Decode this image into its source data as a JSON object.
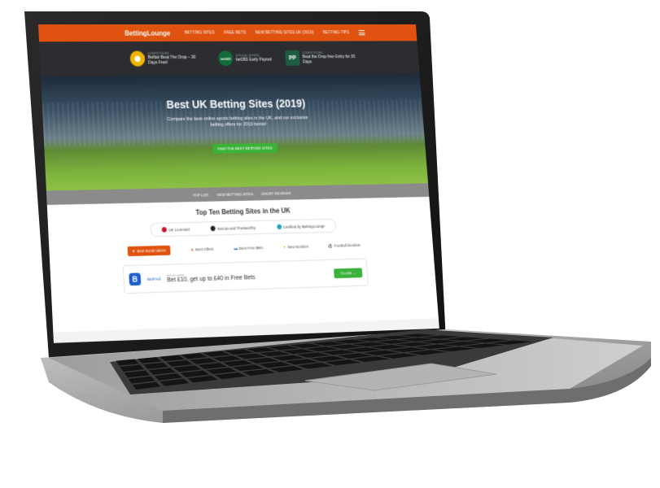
{
  "nav": {
    "brand": "BettingLounge",
    "links": [
      "BETTING SITES",
      "FREE BETS",
      "NEW BETTING SITES UK (2019)",
      "BETTING TIPS"
    ]
  },
  "promos": [
    {
      "logo_text": "",
      "logo_color": "#f0b400",
      "kicker": "COMPETITIONS",
      "title": "Betfair Beat The Drop – 30 Days Free!"
    },
    {
      "logo_text": "bet365",
      "logo_color": "#136c3b",
      "kicker": "SPECIAL OFFERS",
      "title": "bet365 Early Payout"
    },
    {
      "logo_text": "PP",
      "logo_color": "#1d5e42",
      "kicker": "COMPETITIONS",
      "title": "Beat the Drop free Entry for 30 Days"
    }
  ],
  "hero": {
    "title": "Best UK Betting Sites (2019)",
    "subtitle": "Compare the best online sports betting sites in the UK, and our exclusive betting offers for 2019 below!",
    "cta": "FIND THE BEST BETTING SITES"
  },
  "tabs": [
    "TOP LIST",
    "NEW BETTING SITES",
    "SHORT REVIEWS"
  ],
  "content": {
    "heading": "Top Ten Betting Sites in the UK",
    "badges": [
      {
        "label": "UK Licensed",
        "color": "#c8102e"
      },
      {
        "label": "Secure and Trustworthy",
        "color": "#222222"
      },
      {
        "label": "Certified by BettingLounge",
        "color": "#2aa2c7"
      }
    ],
    "filters": [
      {
        "label": "Best Bookmakers",
        "active": true
      },
      {
        "label": "Best Offers",
        "active": false
      },
      {
        "label": "Best Free Bets",
        "active": false
      },
      {
        "label": "New Bookies",
        "active": false
      },
      {
        "label": "Football Bookies",
        "active": false
      }
    ],
    "card": {
      "logo": "B",
      "name": "BetFred",
      "kicker": "BONUS OFFER",
      "headline": "Bet £10, get up to £40 in Free Bets",
      "claim": "CLAIM →"
    }
  },
  "colors": {
    "accent": "#e0520f",
    "green": "#3bb33a"
  }
}
